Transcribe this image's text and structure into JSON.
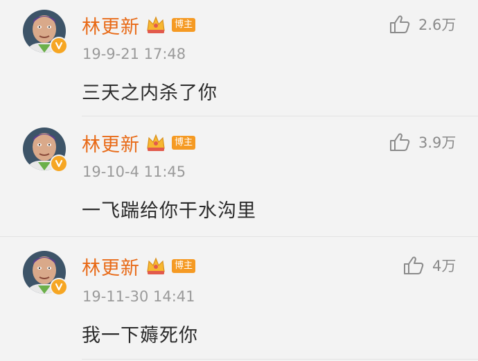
{
  "comments": [
    {
      "username": "林更新",
      "badge": "博主",
      "like_count": "2.6万",
      "time": "19-9-21 17:48",
      "text": "三天之内杀了你"
    },
    {
      "username": "林更新",
      "badge": "博主",
      "like_count": "3.9万",
      "time": "19-10-4 11:45",
      "text": "一飞踹给你干水沟里"
    },
    {
      "username": "林更新",
      "badge": "博主",
      "like_count": "4万",
      "time": "19-11-30 14:41",
      "text": "我一下薅死你"
    }
  ],
  "colors": {
    "username": "#e86a17",
    "badge_bg": "#f59a23",
    "verified_badge": "#f6a623",
    "text": "#2a2a2a",
    "meta": "#9a9a9a",
    "background": "#f3f3f3"
  },
  "icons": {
    "avatar": "buzz-lightyear-avatar",
    "verified": "verified-v-icon",
    "crown": "crown-icon",
    "like": "thumbs-up-icon"
  }
}
